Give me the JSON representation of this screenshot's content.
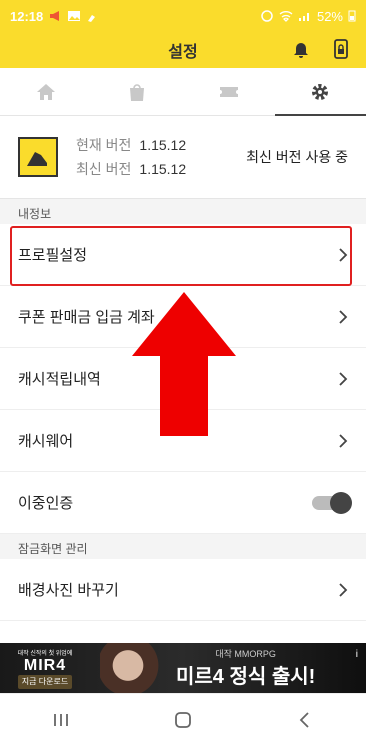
{
  "status_bar": {
    "time": "12:18",
    "battery": "52%"
  },
  "app_bar": {
    "title": "설정"
  },
  "tabs": [
    {
      "icon": "home-icon"
    },
    {
      "icon": "shopping-bag-icon"
    },
    {
      "icon": "ticket-icon"
    },
    {
      "icon": "gear-icon",
      "active": true
    }
  ],
  "version": {
    "current_label": "현재 버전",
    "current_value": "1.15.12",
    "latest_label": "최신 버전",
    "latest_value": "1.15.12",
    "status": "최신 버전 사용 중"
  },
  "sections": [
    {
      "title": "내정보"
    },
    {
      "title": "잠금화면 관리"
    }
  ],
  "rows": [
    {
      "label": "프로필설정"
    },
    {
      "label": "쿠폰 판매금 입금 계좌"
    },
    {
      "label": "캐시적립내역"
    },
    {
      "label": "캐시웨어"
    },
    {
      "label": "이중인증"
    },
    {
      "label": "배경사진 바꾸기"
    }
  ],
  "ad": {
    "brand_small": "대작 신작의 첫 위엄에",
    "brand": "MIR4",
    "download": "지금 다운로드",
    "tag": "대작 MMORPG",
    "headline": "미르4 정식 출시!",
    "info": "i"
  },
  "colors": {
    "accent": "#fadc2c",
    "highlight": "#e02020"
  }
}
